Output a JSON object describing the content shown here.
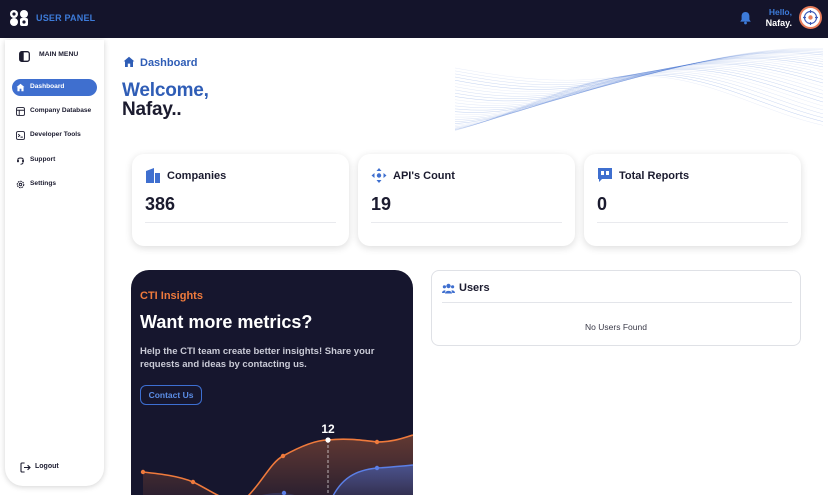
{
  "header": {
    "panel_title": "USER PANEL",
    "greeting": "Hello,",
    "user_name": "Nafay."
  },
  "sidebar": {
    "menu_title": "MAIN MENU",
    "items": [
      {
        "label": "Dashboard",
        "icon": "home-icon",
        "active": true
      },
      {
        "label": "Company Database",
        "icon": "table-icon",
        "active": false
      },
      {
        "label": "Developer Tools",
        "icon": "terminal-icon",
        "active": false
      },
      {
        "label": "Support",
        "icon": "support-icon",
        "active": false
      },
      {
        "label": "Settings",
        "icon": "gear-icon",
        "active": false
      }
    ],
    "logout_label": "Logout"
  },
  "page": {
    "breadcrumb": "Dashboard",
    "welcome_line1": "Welcome,",
    "welcome_line2": "Nafay.."
  },
  "stats": [
    {
      "title": "Companies",
      "value": "386",
      "icon": "building-icon"
    },
    {
      "title": "API's Count",
      "value": "19",
      "icon": "api-icon"
    },
    {
      "title": "Total Reports",
      "value": "0",
      "icon": "report-icon"
    }
  ],
  "cti": {
    "kicker": "CTI Insights",
    "title": "Want more metrics?",
    "body": "Help the CTI team create better insights! Share your requests and ideas by contacting us.",
    "button_label": "Contact Us",
    "highlight_label": "12"
  },
  "users": {
    "title": "Users",
    "empty_message": "No Users Found"
  },
  "colors": {
    "topbar": "#14142b",
    "accent_blue": "#3f6fcf",
    "accent_orange": "#ef7a3c",
    "card_dark": "#16162e"
  }
}
